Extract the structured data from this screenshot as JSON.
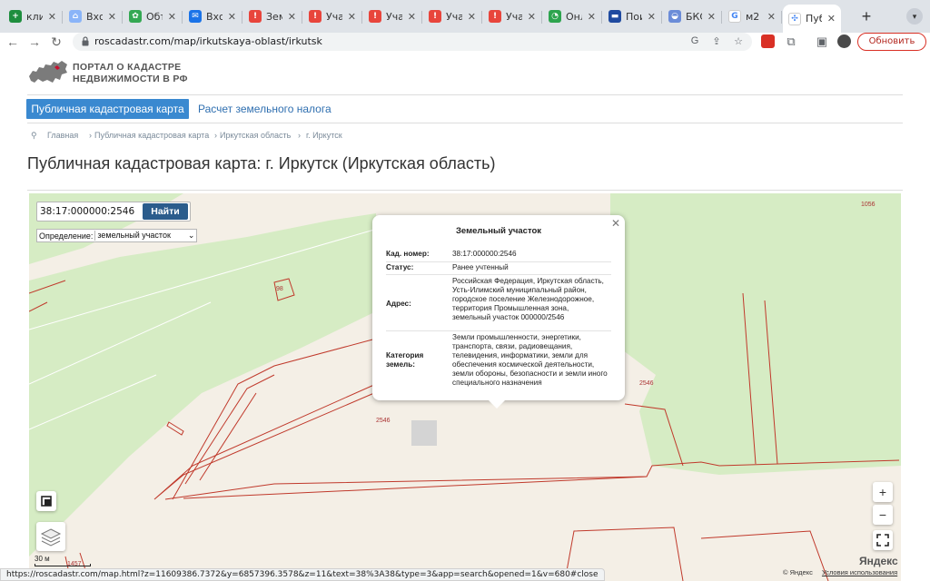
{
  "browser": {
    "tabs": [
      {
        "label": "кли",
        "color": "#1e8e3e",
        "glyph": "+"
      },
      {
        "label": "Вхо",
        "color": "#8ab4f8",
        "glyph": "⌂"
      },
      {
        "label": "Объ",
        "color": "#34a853",
        "glyph": "✿"
      },
      {
        "label": "Вхо",
        "color": "#1a73e8",
        "glyph": "✉"
      },
      {
        "label": "Зем",
        "color": "#e8453c",
        "glyph": "!"
      },
      {
        "label": "Уча",
        "color": "#e8453c",
        "glyph": "!"
      },
      {
        "label": "Уча",
        "color": "#e8453c",
        "glyph": "!"
      },
      {
        "label": "Уча",
        "color": "#e8453c",
        "glyph": "!"
      },
      {
        "label": "Уча",
        "color": "#e8453c",
        "glyph": "!"
      },
      {
        "label": "Онл",
        "color": "#2da44e",
        "glyph": "◔"
      },
      {
        "label": "Пои",
        "color": "#1f4aa0",
        "glyph": "▬"
      },
      {
        "label": "БКС",
        "color": "#6b8cd8",
        "glyph": "◒"
      },
      {
        "label": "м2 ",
        "color": "#ffffff",
        "glyph": "G"
      },
      {
        "label": "Пуб",
        "color": "#ffffff",
        "glyph": "✣"
      }
    ],
    "active_tab": 13,
    "new_tab": "+",
    "url": "roscadastr.com/map/irkutskaya-oblast/irkutsk",
    "update_label": "Обновить",
    "status_url": "https://roscadastr.com/map.html?z=11609386.7372&y=6857396.3578&z=11&text=38%3A38&type=3&app=search&opened=1&v=680#close"
  },
  "site": {
    "logo_line1": "ПОРТАЛ О КАДАСТРЕ",
    "logo_line2": "НЕДВИЖИМОСТИ В РФ",
    "nav_active": "Публичная кадастровая карта",
    "nav_other": "Расчет земельного налога",
    "breadcrumbs": [
      "Главная",
      "Публичная кадастровая карта",
      "Иркутская область",
      "г. Иркутск"
    ],
    "page_title": "Публичная кадастровая карта: г. Иркутск (Иркутская область)"
  },
  "map": {
    "search_value": "38:17:000000:2546",
    "search_button": "Найти",
    "definition_label": "Определение:",
    "definition_value": "земельный участок",
    "popup": {
      "title": "Земельный участок",
      "rows": [
        {
          "label": "Кад. номер:",
          "value": "38:17:000000:2546"
        },
        {
          "label": "Статус:",
          "value": "Ранее учтенный"
        },
        {
          "label": "Адрес:",
          "value": "Российская Федерация, Иркутская область, Усть-Илимский муниципальный район, городское поселение Железнодорожное, территория Промышленная зона, земельный участок 000000/2546"
        },
        {
          "label": "Категория земель:",
          "value": "Земли промышленности, энергетики, транспорта, связи, радиовещания, телевидения, информатики, земли для обеспечения космической деятельности, земли обороны, безопасности и земли иного специального назначения"
        }
      ]
    },
    "labels": [
      "1056",
      "2546",
      "2546",
      "98",
      "1457"
    ],
    "scale": "30 м",
    "provider": "Яндекс",
    "copyright": "© Яндекс",
    "terms": "Условия использования",
    "zoom_in": "+",
    "zoom_out": "−",
    "colors": {
      "land": "#f4efe6",
      "green": "#d6ecc4",
      "parcel": "#c0392b"
    }
  }
}
